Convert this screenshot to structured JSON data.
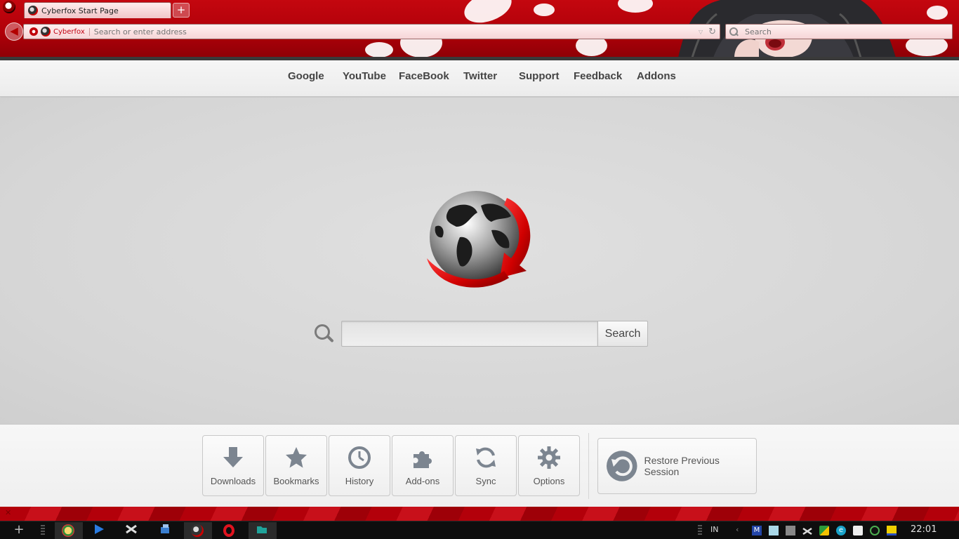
{
  "window": {
    "tab_title": "Cyberfox Start Page",
    "new_tab_symbol": "+"
  },
  "navbar": {
    "back_symbol": "◀",
    "identity_label": "Cyberfox",
    "url_placeholder": "Search or enter address",
    "dropdown_symbol": "▽",
    "reload_symbol": "↻",
    "search_placeholder": "Search"
  },
  "topnav": {
    "links": [
      "Google",
      "YouTube",
      "FaceBook",
      "Twitter",
      "Support",
      "Feedback",
      "Addons"
    ]
  },
  "search": {
    "button_label": "Search",
    "input_value": ""
  },
  "launcher": {
    "items": [
      {
        "label": "Downloads",
        "icon": "download-icon"
      },
      {
        "label": "Bookmarks",
        "icon": "star-icon"
      },
      {
        "label": "History",
        "icon": "clock-icon"
      },
      {
        "label": "Add-ons",
        "icon": "puzzle-icon"
      },
      {
        "label": "Sync",
        "icon": "sync-icon"
      },
      {
        "label": "Options",
        "icon": "gear-icon"
      }
    ],
    "restore_label": "Restore Previous Session"
  },
  "taskbar": {
    "language": "IN",
    "clock": "22:01"
  },
  "colors": {
    "theme_red": "#c4070f",
    "icon_gray": "#7c8590"
  }
}
